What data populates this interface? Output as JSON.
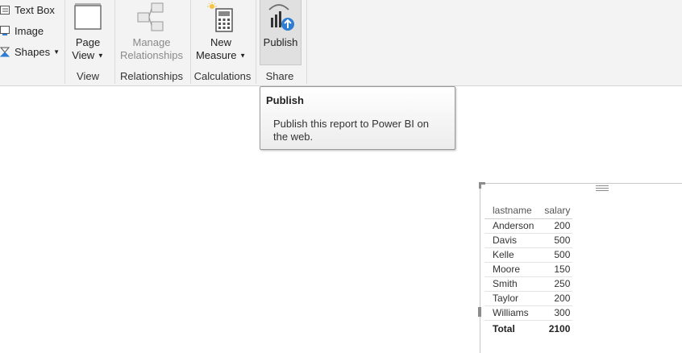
{
  "ribbon": {
    "insert_items": [
      {
        "label": "Text Box",
        "icon": "text-box-icon"
      },
      {
        "label": "Image",
        "icon": "image-icon"
      },
      {
        "label": "Shapes",
        "icon": "shapes-icon"
      }
    ],
    "view": {
      "button_line1": "Page",
      "button_line2": "View",
      "group_label": "View"
    },
    "relationships": {
      "button_line1": "Manage",
      "button_line2": "Relationships",
      "group_label": "Relationships"
    },
    "calculations": {
      "button_line1": "New",
      "button_line2": "Measure",
      "group_label": "Calculations"
    },
    "share": {
      "button_label": "Publish",
      "group_label": "Share"
    }
  },
  "tooltip": {
    "title": "Publish",
    "body": "Publish this report to Power BI on the web."
  },
  "table_visual": {
    "headers": [
      "lastname",
      "salary"
    ],
    "rows": [
      [
        "Anderson",
        "200"
      ],
      [
        "Davis",
        "500"
      ],
      [
        "Kelle",
        "500"
      ],
      [
        "Moore",
        "150"
      ],
      [
        "Smith",
        "250"
      ],
      [
        "Taylor",
        "200"
      ],
      [
        "Williams",
        "300"
      ]
    ],
    "total": [
      "Total",
      "2100"
    ]
  },
  "colors": {
    "accent": "#2e7dd1",
    "ribbon_bg": "#f3f3f3",
    "icon_gray": "#6e6e6e"
  }
}
